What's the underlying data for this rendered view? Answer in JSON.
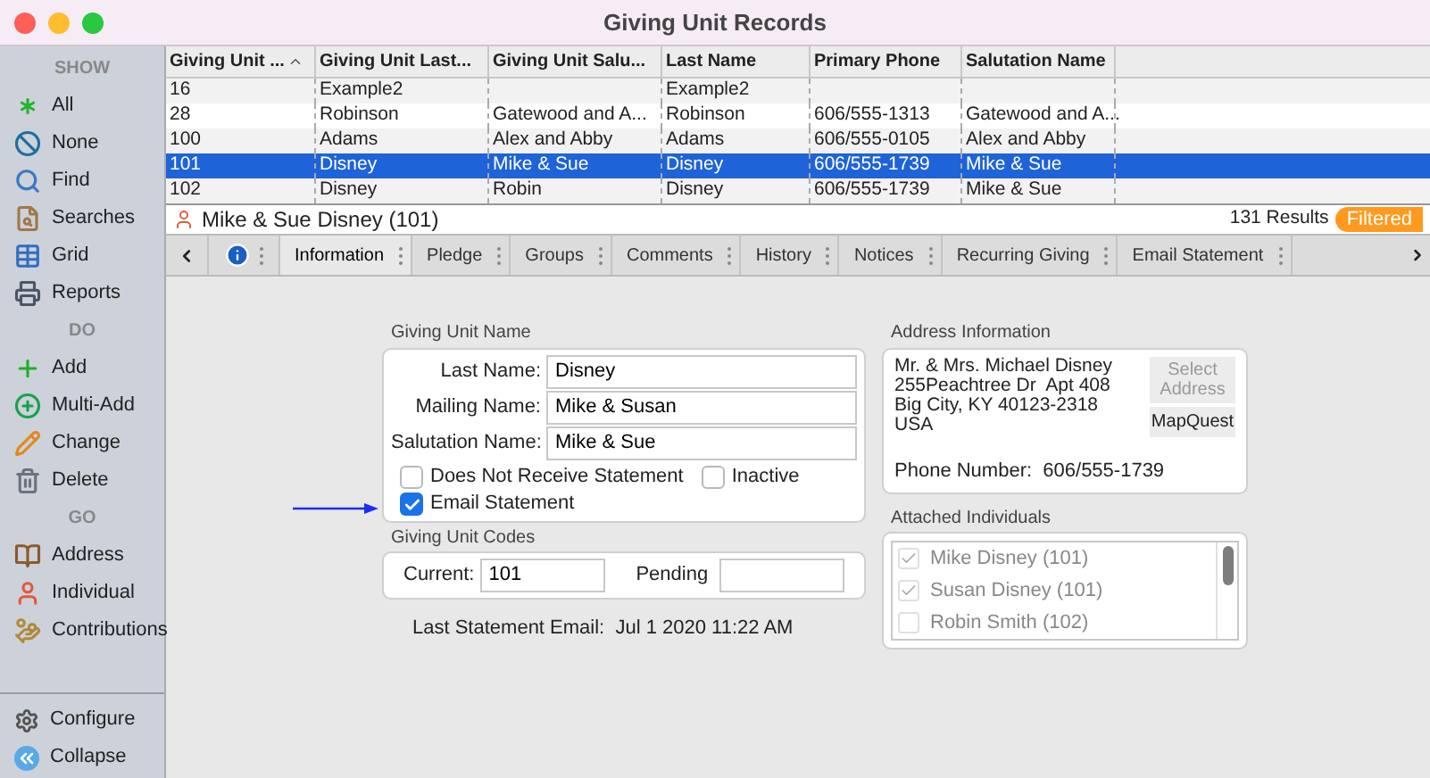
{
  "window": {
    "title": "Giving Unit Records"
  },
  "sidebar": {
    "sections": [
      {
        "heading": "SHOW",
        "items": [
          "All",
          "None",
          "Find",
          "Searches",
          "Grid",
          "Reports"
        ]
      },
      {
        "heading": "DO",
        "items": [
          "Add",
          "Multi-Add",
          "Change",
          "Delete"
        ]
      },
      {
        "heading": "GO",
        "items": [
          "Address",
          "Individual",
          "Contributions"
        ]
      }
    ],
    "footer_items": [
      "Configure",
      "Collapse"
    ]
  },
  "table": {
    "columns": [
      "Giving Unit ...",
      "Giving Unit Last...",
      "Giving Unit Salu...",
      "Last Name",
      "Primary Phone",
      "Salutation Name"
    ],
    "rows": [
      {
        "cells": [
          "16",
          "Example2",
          "",
          "Example2",
          "",
          ""
        ],
        "selected": false
      },
      {
        "cells": [
          "28",
          "Robinson",
          "Gatewood and A...",
          "Robinson",
          "606/555-1313",
          "Gatewood and A..."
        ],
        "selected": false
      },
      {
        "cells": [
          "100",
          "Adams",
          "Alex and Abby",
          "Adams",
          "606/555-0105",
          "Alex and Abby"
        ],
        "selected": false
      },
      {
        "cells": [
          "101",
          "Disney",
          "Mike & Sue",
          "Disney",
          "606/555-1739",
          "Mike & Sue"
        ],
        "selected": true
      },
      {
        "cells": [
          "102",
          "Disney",
          "Robin",
          "Disney",
          "606/555-1739",
          "Mike & Sue"
        ],
        "selected": false
      }
    ]
  },
  "record": {
    "title": "Mike & Sue Disney (101)",
    "results": "131 Results",
    "filter_badge": "Filtered"
  },
  "tabs": [
    {
      "label": "Information",
      "selected": true
    },
    {
      "label": "Pledge",
      "selected": false
    },
    {
      "label": "Groups",
      "selected": false
    },
    {
      "label": "Comments",
      "selected": false
    },
    {
      "label": "History",
      "selected": false
    },
    {
      "label": "Notices",
      "selected": false
    },
    {
      "label": "Recurring Giving",
      "selected": false
    },
    {
      "label": "Email Statement",
      "selected": false
    }
  ],
  "giving_unit_name": {
    "title": "Giving Unit Name",
    "fields": [
      {
        "label": "Last Name:",
        "value": "Disney"
      },
      {
        "label": "Mailing Name:",
        "value": "Mike & Susan"
      },
      {
        "label": "Salutation Name:",
        "value": "Mike & Sue"
      }
    ],
    "checkboxes": [
      {
        "label": "Does Not Receive Statement",
        "checked": false
      },
      {
        "label": "Inactive",
        "checked": false
      },
      {
        "label": "Email Statement",
        "checked": true
      }
    ]
  },
  "giving_unit_codes": {
    "title": "Giving Unit Codes",
    "current_label": "Current:",
    "current_value": "101",
    "pending_label": "Pending"
  },
  "last_statement": "Last Statement Email:  Jul 1 2020 11:22 AM",
  "address": {
    "title": "Address Information",
    "lines": [
      "Mr. & Mrs. Michael Disney",
      "255Peachtree Dr  Apt 408",
      "Big City, KY 40123-2318",
      "USA"
    ],
    "phone": "Phone Number:  606/555-1739",
    "select_button": {
      "label": "Select Address",
      "disabled": true
    },
    "map_button": "MapQuest"
  },
  "attached_individuals": {
    "title": "Attached Individuals",
    "items": [
      {
        "name": "Mike Disney (101)",
        "checked": true
      },
      {
        "name": "Susan Disney (101)",
        "checked": true
      },
      {
        "name": "Robin Smith (102)",
        "checked": false
      }
    ]
  }
}
